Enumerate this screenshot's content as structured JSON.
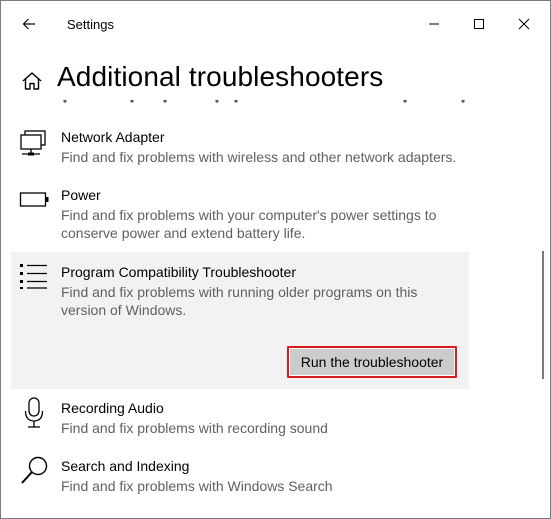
{
  "window": {
    "title": "Settings"
  },
  "page": {
    "title": "Additional troubleshooters"
  },
  "items": [
    {
      "name": "Network Adapter",
      "description": "Find and fix problems with wireless and other network adapters."
    },
    {
      "name": "Power",
      "description": "Find and fix problems with your computer's power settings to conserve power and extend battery life."
    },
    {
      "name": "Program Compatibility Troubleshooter",
      "description": "Find and fix problems with running older programs on this version of Windows.",
      "button": "Run the troubleshooter"
    },
    {
      "name": "Recording Audio",
      "description": "Find and fix problems with recording sound"
    },
    {
      "name": "Search and Indexing",
      "description": "Find and fix problems with Windows Search"
    }
  ],
  "icons": {
    "back": "back-arrow-icon",
    "minimize": "minimize-icon",
    "maximize": "maximize-icon",
    "close": "close-icon",
    "home": "home-icon",
    "network": "network-adapter-icon",
    "power": "battery-icon",
    "program": "list-icon",
    "microphone": "microphone-icon",
    "search": "search-icon"
  },
  "colors": {
    "selected_bg": "#f2f2f2",
    "button_bg": "#cccccc",
    "highlight_border": "#d81b1b",
    "secondary_text": "#606060"
  }
}
